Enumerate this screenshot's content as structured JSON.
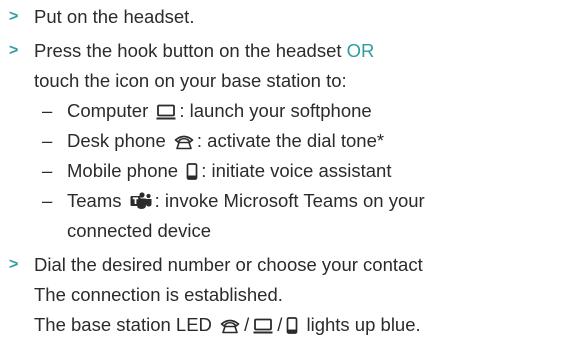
{
  "steps": [
    {
      "text": "Put on the headset."
    },
    {
      "line1_prefix": "Press the hook button on the headset",
      "line1_accent": "OR",
      "line2": "touch the icon on your base station to:",
      "items": [
        {
          "label": "Computer",
          "icon": "computer-icon",
          "desc": ":  launch your softphone"
        },
        {
          "label": "Desk phone",
          "icon": "desk-phone-icon",
          "desc": ": activate the dial tone*"
        },
        {
          "label": "Mobile phone",
          "icon": "mobile-phone-icon",
          "desc": ": initiate voice assistant"
        },
        {
          "label": "Teams",
          "icon": "teams-icon",
          "desc": ": invoke Microsoft Teams on your",
          "cont": "connected device"
        }
      ]
    },
    {
      "line1": "Dial the desired number or choose your contact",
      "line2": "The connection is established.",
      "line3_prefix": "The base station LED",
      "line3_sep": "/",
      "line3_suffix": "lights up blue.",
      "icons": [
        "desk-phone-icon",
        "computer-icon",
        "mobile-phone-icon"
      ]
    }
  ],
  "colors": {
    "accent": "#2e9ea3",
    "text": "#2b2b2b"
  }
}
